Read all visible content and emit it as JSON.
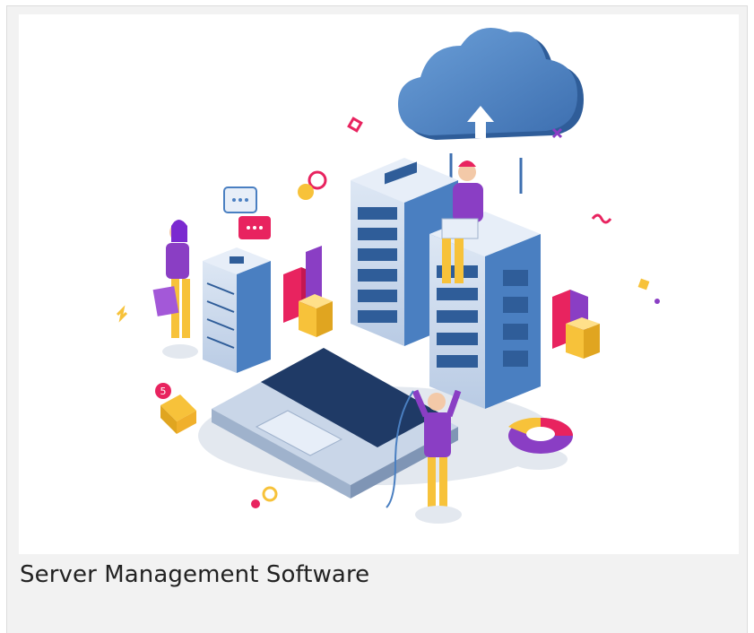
{
  "card": {
    "caption": "Server Management Software",
    "image_alt": "Isometric illustration of people working with server racks, a laptop and a cloud upload"
  },
  "colors": {
    "card_background": "#f2f2f2",
    "server_blue": "#4a7fc1",
    "accent_purple": "#8a3ec4",
    "accent_pink": "#e8235f",
    "accent_yellow": "#f7c23a"
  },
  "icons": [
    "cloud-upload-icon",
    "chat-bubble-icon",
    "mail-icon",
    "bar-chart-icon",
    "pie-chart-icon"
  ],
  "mail_badge": "5"
}
